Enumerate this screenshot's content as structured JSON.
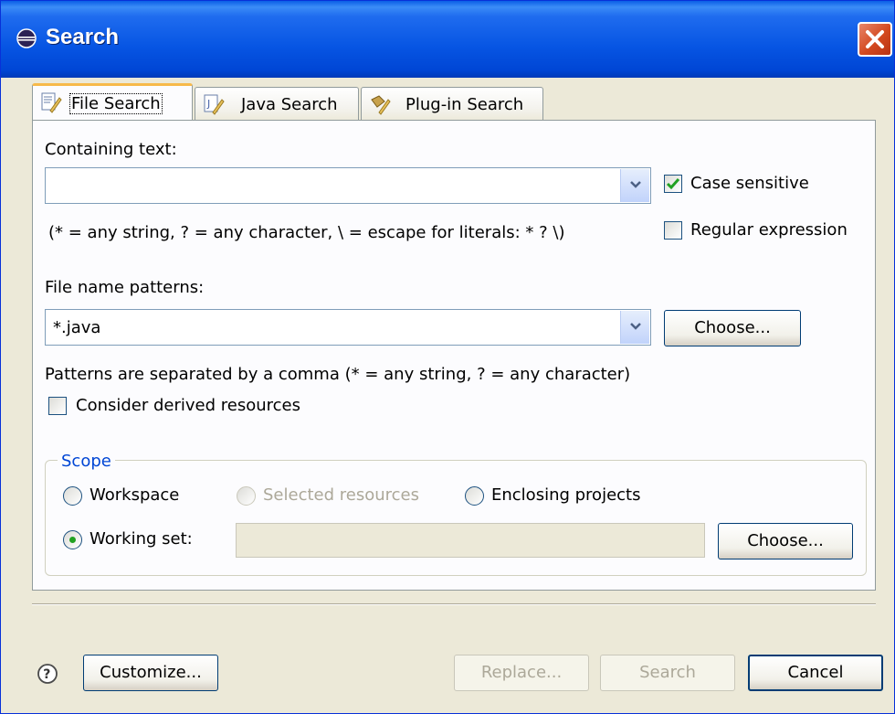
{
  "window": {
    "title": "Search"
  },
  "tabs": [
    {
      "label": "File Search",
      "icon": "file-search-icon"
    },
    {
      "label": "Java Search",
      "icon": "java-search-icon"
    },
    {
      "label": "Plug-in Search",
      "icon": "plugin-search-icon"
    }
  ],
  "containing": {
    "label": "Containing text:",
    "value": "",
    "hint": "(* = any string, ? = any character, \\ = escape for literals: * ? \\)",
    "case_sensitive": {
      "label": "Case sensitive",
      "checked": true
    },
    "regex": {
      "label": "Regular expression",
      "checked": false
    }
  },
  "patterns": {
    "label": "File name patterns:",
    "value": "*.java",
    "choose_label": "Choose...",
    "hint": "Patterns are separated by a comma (* = any string, ? = any character)",
    "derived": {
      "label": "Consider derived resources",
      "checked": false
    }
  },
  "scope": {
    "title": "Scope",
    "workspace": "Workspace",
    "selected": "Selected resources",
    "enclosing": "Enclosing projects",
    "working_set": "Working set:",
    "working_set_value": "",
    "choose_label": "Choose...",
    "selected_option": "working_set"
  },
  "footer": {
    "customize": "Customize...",
    "replace": "Replace...",
    "search": "Search",
    "cancel": "Cancel"
  },
  "colors": {
    "titlebar": "#0054e3",
    "accent": "#f7b94a",
    "scope_title": "#0046d5"
  }
}
